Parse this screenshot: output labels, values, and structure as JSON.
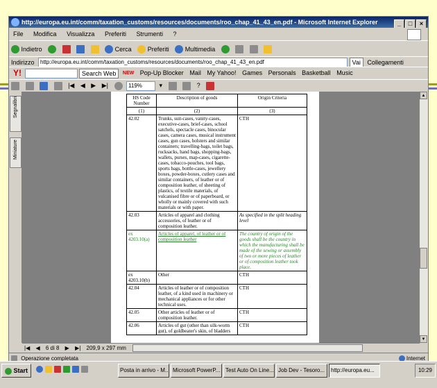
{
  "window": {
    "title": "http://europa.eu.int/comm/taxation_customs/resources/documents/roo_chap_41_43_en.pdf - Microsoft Internet Explorer",
    "controls": [
      "_",
      "□",
      "×"
    ]
  },
  "menu": [
    "File",
    "Modifica",
    "Visualizza",
    "Preferiti",
    "Strumenti",
    "?"
  ],
  "nav_toolbar": {
    "back": "Indietro",
    "search": "Cerca",
    "favorites": "Preferiti",
    "media": "Multimedia"
  },
  "address_bar": {
    "label": "Indirizzo",
    "url": "http://europa.eu.int/comm/taxation_customs/resources/documents/roo_chap_41_43_en.pdf",
    "go_label": "Vai",
    "links_label": "Collegamenti"
  },
  "yahoo_toolbar": {
    "search_button": "Search Web",
    "items": [
      "Pop-Up Blocker",
      "Mail",
      "My Yahoo!",
      "Games",
      "Personals",
      "Basketball",
      "Music"
    ],
    "new_badge": "NEW"
  },
  "pdf_toolbar": {
    "zoom": "119%"
  },
  "side_tabs": [
    "Segnalibri",
    "Miniature"
  ],
  "table": {
    "headers": [
      "HS Code Number",
      "Description of goods",
      "Origin Criteria"
    ],
    "index_row": [
      "(1)",
      "(2)",
      "(3)"
    ],
    "rows": [
      {
        "code": "42.02",
        "desc": "Trunks, suit-cases, vanity-cases, executive-cases, brief-cases, school satchels, spectacle cases, binocular cases, camera cases, musical instrument cases, gun cases, holsters and similar containers; travelling-bags, toilet bags, rucksacks, hand bags, shopping-bags, wallets, purses, map-cases, cigarette-cases, tobacco-pouches, tool bags, sports bags, bottle-cases, jewellery boxes, powder-boxes, cutlery cases and similar containers, of leather or of composition leather, of sheeting of plastics, of textile materials, of vulcanised fibre or of paperboard, or wholly or mainly covered with such materials or with paper.",
        "origin": "CTH",
        "style": "normal"
      },
      {
        "code": "42.03",
        "desc": "Articles of apparel and clothing accessories, of leather or of composition leather.",
        "origin": "As specified in the split heading level",
        "style": "italic-origin"
      },
      {
        "code": "ex 4203.10(a)",
        "desc": "Articles of apparel, of leather or of composition leather",
        "origin": "The country of origin of the goods shall be the country in which the manufacturing shall be made of the sewing or assembly of two or more pieces of leather or of composition leather took place.",
        "style": "green"
      },
      {
        "code": "ex 4203.10(b)",
        "desc": "Other",
        "origin": "CTH",
        "style": "normal"
      },
      {
        "code": "42.04",
        "desc": "Articles of leather or of composition leather, of a kind used in machinery or mechanical appliances or for other technical uses.",
        "origin": "CTH",
        "style": "normal"
      },
      {
        "code": "42.05",
        "desc": "Other articles of leather or of composition leather.",
        "origin": "CTH",
        "style": "normal"
      },
      {
        "code": "42.06",
        "desc": "Articles of gut (other than silk-worm gut), of goldbeater's skin, of bladders",
        "origin": "CTH",
        "style": "normal"
      }
    ]
  },
  "pdf_status": {
    "page_info": "6 di 8",
    "page_size": "209,9 x 297 mm"
  },
  "ie_status": {
    "left": "Operazione completata",
    "zone": "Internet"
  },
  "taskbar": {
    "start": "Start",
    "tasks": [
      "Posta in arrivo - M...",
      "Microsoft PowerP...",
      "Test Auto On Line...",
      "Job Dev - Tesoro...",
      "http://europa.eu..."
    ],
    "active_index": 4,
    "clock": "10:29"
  },
  "colors": {
    "background": "#ffffcc",
    "title_gradient_start": "#0a246a",
    "green_text": "#2e7d2e"
  }
}
